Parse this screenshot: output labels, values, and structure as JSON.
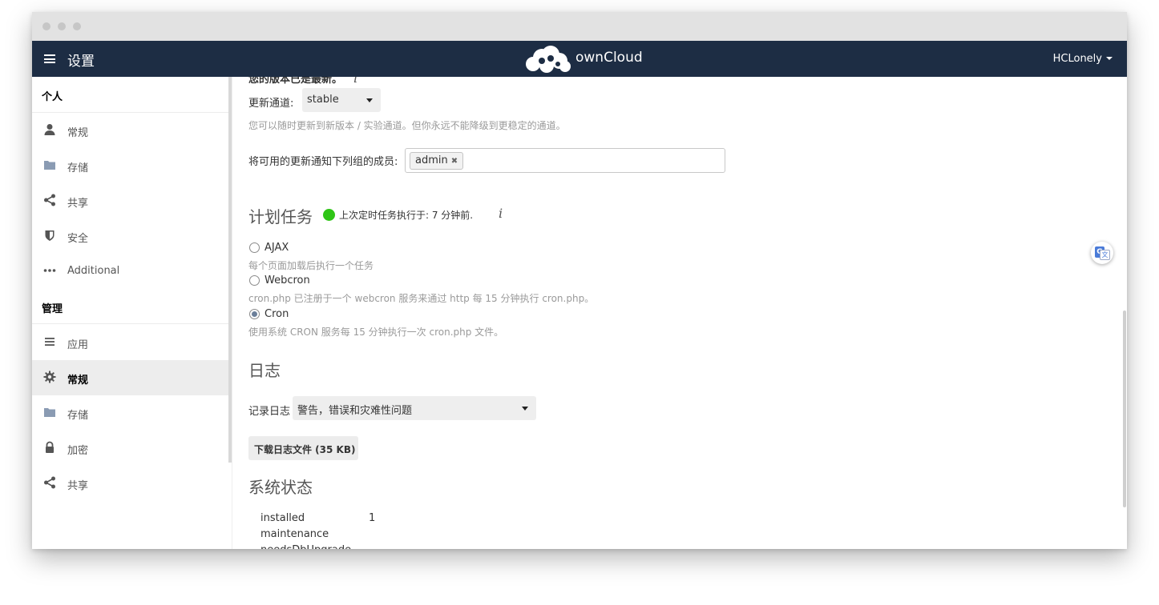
{
  "header": {
    "app_title": "设置",
    "brand": "ownCloud",
    "user": "HCLonely"
  },
  "sidebar": {
    "personal_heading": "个人",
    "personal_items": [
      {
        "label": "常规",
        "icon": "user-icon"
      },
      {
        "label": "存储",
        "icon": "folder-icon"
      },
      {
        "label": "共享",
        "icon": "share-icon"
      },
      {
        "label": "安全",
        "icon": "shield-icon"
      },
      {
        "label": "Additional",
        "icon": "more-icon"
      }
    ],
    "admin_heading": "管理",
    "admin_items": [
      {
        "label": "应用",
        "icon": "list-icon"
      },
      {
        "label": "常规",
        "icon": "gear-icon",
        "active": true
      },
      {
        "label": "存储",
        "icon": "folder-icon"
      },
      {
        "label": "加密",
        "icon": "lock-icon"
      },
      {
        "label": "共享",
        "icon": "share-icon"
      }
    ]
  },
  "updates": {
    "status_partial": "您的版本已是最新。",
    "channel_label": "更新通道:",
    "channel_value": "stable",
    "channel_hint": "您可以随时更新到新版本 / 实验通道。但你永远不能降级到更稳定的通道。",
    "notify_label": "将可用的更新通知下列组的成员:",
    "notify_tag": "admin"
  },
  "cron": {
    "title": "计划任务",
    "last_run": "上次定时任务执行于: 7 分钟前.",
    "options": [
      {
        "label": "AJAX",
        "desc": "每个页面加载后执行一个任务",
        "checked": false
      },
      {
        "label": "Webcron",
        "desc": "cron.php 已注册于一个 webcron 服务来通过 http 每 15 分钟执行 cron.php。",
        "checked": false
      },
      {
        "label": "Cron",
        "desc": "使用系统 CRON 服务每 15 分钟执行一次 cron.php 文件。",
        "checked": true
      }
    ]
  },
  "log": {
    "title": "日志",
    "level_label": "记录日志",
    "level_value": "警告，错误和灾难性问题",
    "download_button": "下载日志文件 (35 KB)"
  },
  "system_status": {
    "title": "系统状态",
    "rows": [
      {
        "key": "installed",
        "value": "1"
      },
      {
        "key": "maintenance",
        "value": ""
      },
      {
        "key": "needsDbUpgrade",
        "value": ""
      }
    ]
  },
  "colors": {
    "header_bg": "#1d2d44",
    "status_green": "#2fc516"
  }
}
